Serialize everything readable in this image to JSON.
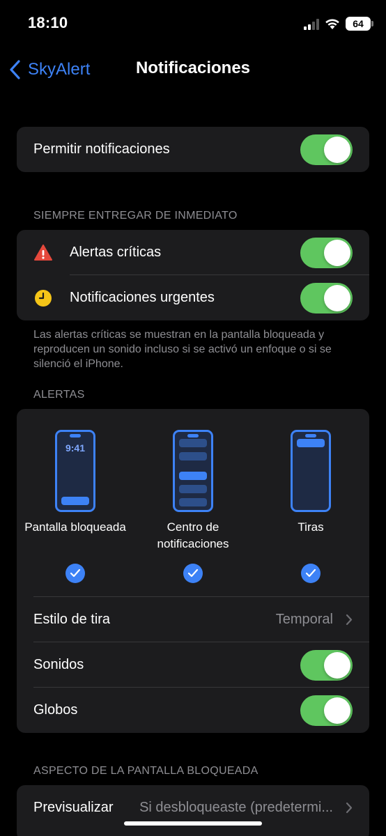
{
  "status_bar": {
    "time": "18:10",
    "battery": "64"
  },
  "nav": {
    "back_label": "SkyAlert",
    "title": "Notificaciones"
  },
  "allow": {
    "label": "Permitir notificaciones",
    "on": true
  },
  "immediate": {
    "header": "SIEMPRE ENTREGAR DE INMEDIATO",
    "critical_label": "Alertas críticas",
    "urgent_label": "Notificaciones urgentes",
    "footer": "Las alertas críticas se muestran en la pantalla bloqueada y reproducen un sonido incluso si se activó un enfoque o si se silenció el iPhone."
  },
  "alerts": {
    "header": "ALERTAS",
    "lock_screen_time": "9:41",
    "options": [
      {
        "label": "Pantalla bloqueada",
        "checked": true
      },
      {
        "label": "Centro de notificaciones",
        "checked": true
      },
      {
        "label": "Tiras",
        "checked": true
      }
    ],
    "banner_style_label": "Estilo de tira",
    "banner_style_value": "Temporal",
    "sounds_label": "Sonidos",
    "badges_label": "Globos"
  },
  "lock_appearance": {
    "header": "ASPECTO DE LA PANTALLA BLOQUEADA",
    "preview_label": "Previsualizar",
    "preview_value": "Si desbloqueaste (predetermi..."
  },
  "colors": {
    "accent": "#3d82f6",
    "toggle_on": "#5fc65f",
    "warning": "#e5483c",
    "clock_icon": "#f5c518"
  }
}
